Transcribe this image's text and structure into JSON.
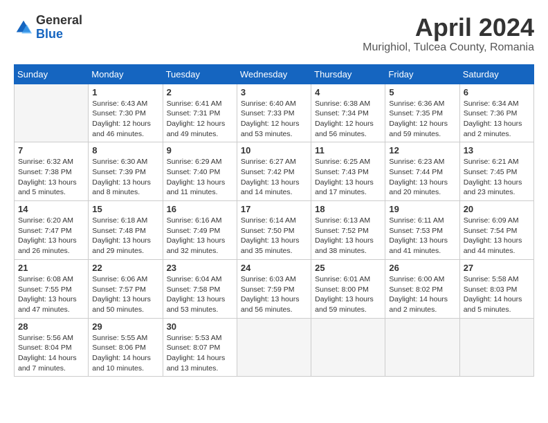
{
  "header": {
    "logo_line1": "General",
    "logo_line2": "Blue",
    "month": "April 2024",
    "location": "Murighiol, Tulcea County, Romania"
  },
  "weekdays": [
    "Sunday",
    "Monday",
    "Tuesday",
    "Wednesday",
    "Thursday",
    "Friday",
    "Saturday"
  ],
  "weeks": [
    [
      {
        "day": "",
        "info": ""
      },
      {
        "day": "1",
        "info": "Sunrise: 6:43 AM\nSunset: 7:30 PM\nDaylight: 12 hours\nand 46 minutes."
      },
      {
        "day": "2",
        "info": "Sunrise: 6:41 AM\nSunset: 7:31 PM\nDaylight: 12 hours\nand 49 minutes."
      },
      {
        "day": "3",
        "info": "Sunrise: 6:40 AM\nSunset: 7:33 PM\nDaylight: 12 hours\nand 53 minutes."
      },
      {
        "day": "4",
        "info": "Sunrise: 6:38 AM\nSunset: 7:34 PM\nDaylight: 12 hours\nand 56 minutes."
      },
      {
        "day": "5",
        "info": "Sunrise: 6:36 AM\nSunset: 7:35 PM\nDaylight: 12 hours\nand 59 minutes."
      },
      {
        "day": "6",
        "info": "Sunrise: 6:34 AM\nSunset: 7:36 PM\nDaylight: 13 hours\nand 2 minutes."
      }
    ],
    [
      {
        "day": "7",
        "info": "Sunrise: 6:32 AM\nSunset: 7:38 PM\nDaylight: 13 hours\nand 5 minutes."
      },
      {
        "day": "8",
        "info": "Sunrise: 6:30 AM\nSunset: 7:39 PM\nDaylight: 13 hours\nand 8 minutes."
      },
      {
        "day": "9",
        "info": "Sunrise: 6:29 AM\nSunset: 7:40 PM\nDaylight: 13 hours\nand 11 minutes."
      },
      {
        "day": "10",
        "info": "Sunrise: 6:27 AM\nSunset: 7:42 PM\nDaylight: 13 hours\nand 14 minutes."
      },
      {
        "day": "11",
        "info": "Sunrise: 6:25 AM\nSunset: 7:43 PM\nDaylight: 13 hours\nand 17 minutes."
      },
      {
        "day": "12",
        "info": "Sunrise: 6:23 AM\nSunset: 7:44 PM\nDaylight: 13 hours\nand 20 minutes."
      },
      {
        "day": "13",
        "info": "Sunrise: 6:21 AM\nSunset: 7:45 PM\nDaylight: 13 hours\nand 23 minutes."
      }
    ],
    [
      {
        "day": "14",
        "info": "Sunrise: 6:20 AM\nSunset: 7:47 PM\nDaylight: 13 hours\nand 26 minutes."
      },
      {
        "day": "15",
        "info": "Sunrise: 6:18 AM\nSunset: 7:48 PM\nDaylight: 13 hours\nand 29 minutes."
      },
      {
        "day": "16",
        "info": "Sunrise: 6:16 AM\nSunset: 7:49 PM\nDaylight: 13 hours\nand 32 minutes."
      },
      {
        "day": "17",
        "info": "Sunrise: 6:14 AM\nSunset: 7:50 PM\nDaylight: 13 hours\nand 35 minutes."
      },
      {
        "day": "18",
        "info": "Sunrise: 6:13 AM\nSunset: 7:52 PM\nDaylight: 13 hours\nand 38 minutes."
      },
      {
        "day": "19",
        "info": "Sunrise: 6:11 AM\nSunset: 7:53 PM\nDaylight: 13 hours\nand 41 minutes."
      },
      {
        "day": "20",
        "info": "Sunrise: 6:09 AM\nSunset: 7:54 PM\nDaylight: 13 hours\nand 44 minutes."
      }
    ],
    [
      {
        "day": "21",
        "info": "Sunrise: 6:08 AM\nSunset: 7:55 PM\nDaylight: 13 hours\nand 47 minutes."
      },
      {
        "day": "22",
        "info": "Sunrise: 6:06 AM\nSunset: 7:57 PM\nDaylight: 13 hours\nand 50 minutes."
      },
      {
        "day": "23",
        "info": "Sunrise: 6:04 AM\nSunset: 7:58 PM\nDaylight: 13 hours\nand 53 minutes."
      },
      {
        "day": "24",
        "info": "Sunrise: 6:03 AM\nSunset: 7:59 PM\nDaylight: 13 hours\nand 56 minutes."
      },
      {
        "day": "25",
        "info": "Sunrise: 6:01 AM\nSunset: 8:00 PM\nDaylight: 13 hours\nand 59 minutes."
      },
      {
        "day": "26",
        "info": "Sunrise: 6:00 AM\nSunset: 8:02 PM\nDaylight: 14 hours\nand 2 minutes."
      },
      {
        "day": "27",
        "info": "Sunrise: 5:58 AM\nSunset: 8:03 PM\nDaylight: 14 hours\nand 5 minutes."
      }
    ],
    [
      {
        "day": "28",
        "info": "Sunrise: 5:56 AM\nSunset: 8:04 PM\nDaylight: 14 hours\nand 7 minutes."
      },
      {
        "day": "29",
        "info": "Sunrise: 5:55 AM\nSunset: 8:06 PM\nDaylight: 14 hours\nand 10 minutes."
      },
      {
        "day": "30",
        "info": "Sunrise: 5:53 AM\nSunset: 8:07 PM\nDaylight: 14 hours\nand 13 minutes."
      },
      {
        "day": "",
        "info": ""
      },
      {
        "day": "",
        "info": ""
      },
      {
        "day": "",
        "info": ""
      },
      {
        "day": "",
        "info": ""
      }
    ]
  ]
}
